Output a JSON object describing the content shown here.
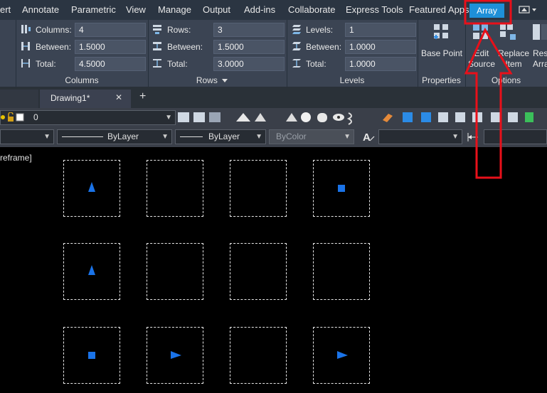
{
  "ribbon_tabs": [
    "ert",
    "Annotate",
    "Parametric",
    "View",
    "Manage",
    "Output",
    "Add-ins",
    "Collaborate",
    "Express Tools",
    "Featured Apps"
  ],
  "active_tab": "Array",
  "panels": {
    "columns": {
      "title": "Columns",
      "rows": [
        {
          "label": "Columns:",
          "value": "4"
        },
        {
          "label": "Between:",
          "value": "1.5000"
        },
        {
          "label": "Total:",
          "value": "4.5000"
        }
      ]
    },
    "rows": {
      "title": "Rows",
      "rows": [
        {
          "label": "Rows:",
          "value": "3"
        },
        {
          "label": "Between:",
          "value": "1.5000"
        },
        {
          "label": "Total:",
          "value": "3.0000"
        }
      ]
    },
    "levels": {
      "title": "Levels",
      "rows": [
        {
          "label": "Levels:",
          "value": "1"
        },
        {
          "label": "Between:",
          "value": "1.0000"
        },
        {
          "label": "Total:",
          "value": "1.0000"
        }
      ]
    },
    "properties": {
      "title": "Properties",
      "base_point": "Base Point"
    },
    "options": {
      "title": "Options",
      "edit_source_1": "Edit",
      "edit_source_2": "Source",
      "replace_item_1": "Replace",
      "replace_item_2": "Item",
      "reset_array_1": "Res",
      "reset_array_2": "Arra"
    }
  },
  "file_tab": {
    "name": "Drawing1*",
    "close": "✕",
    "new": "+"
  },
  "layer": {
    "name": "0"
  },
  "properties_bar": {
    "linetype": "ByLayer",
    "lineweight": "ByLayer",
    "plotstyle": "ByColor"
  },
  "viewport_label": "reframe]",
  "colors": {
    "accent": "#1e90d8",
    "ribbon_bg": "#3b4453",
    "tabbar_bg": "#2b3542",
    "highlight": "#e8101a",
    "entity_blue": "#1a73e8",
    "dashed": "#e8e8e8"
  },
  "grid_items": [
    [
      "triangle",
      "empty",
      "empty",
      "square"
    ],
    [
      "triangle",
      "empty",
      "empty",
      "empty"
    ],
    [
      "square",
      "right-triangle",
      "empty",
      "right-triangle"
    ]
  ]
}
